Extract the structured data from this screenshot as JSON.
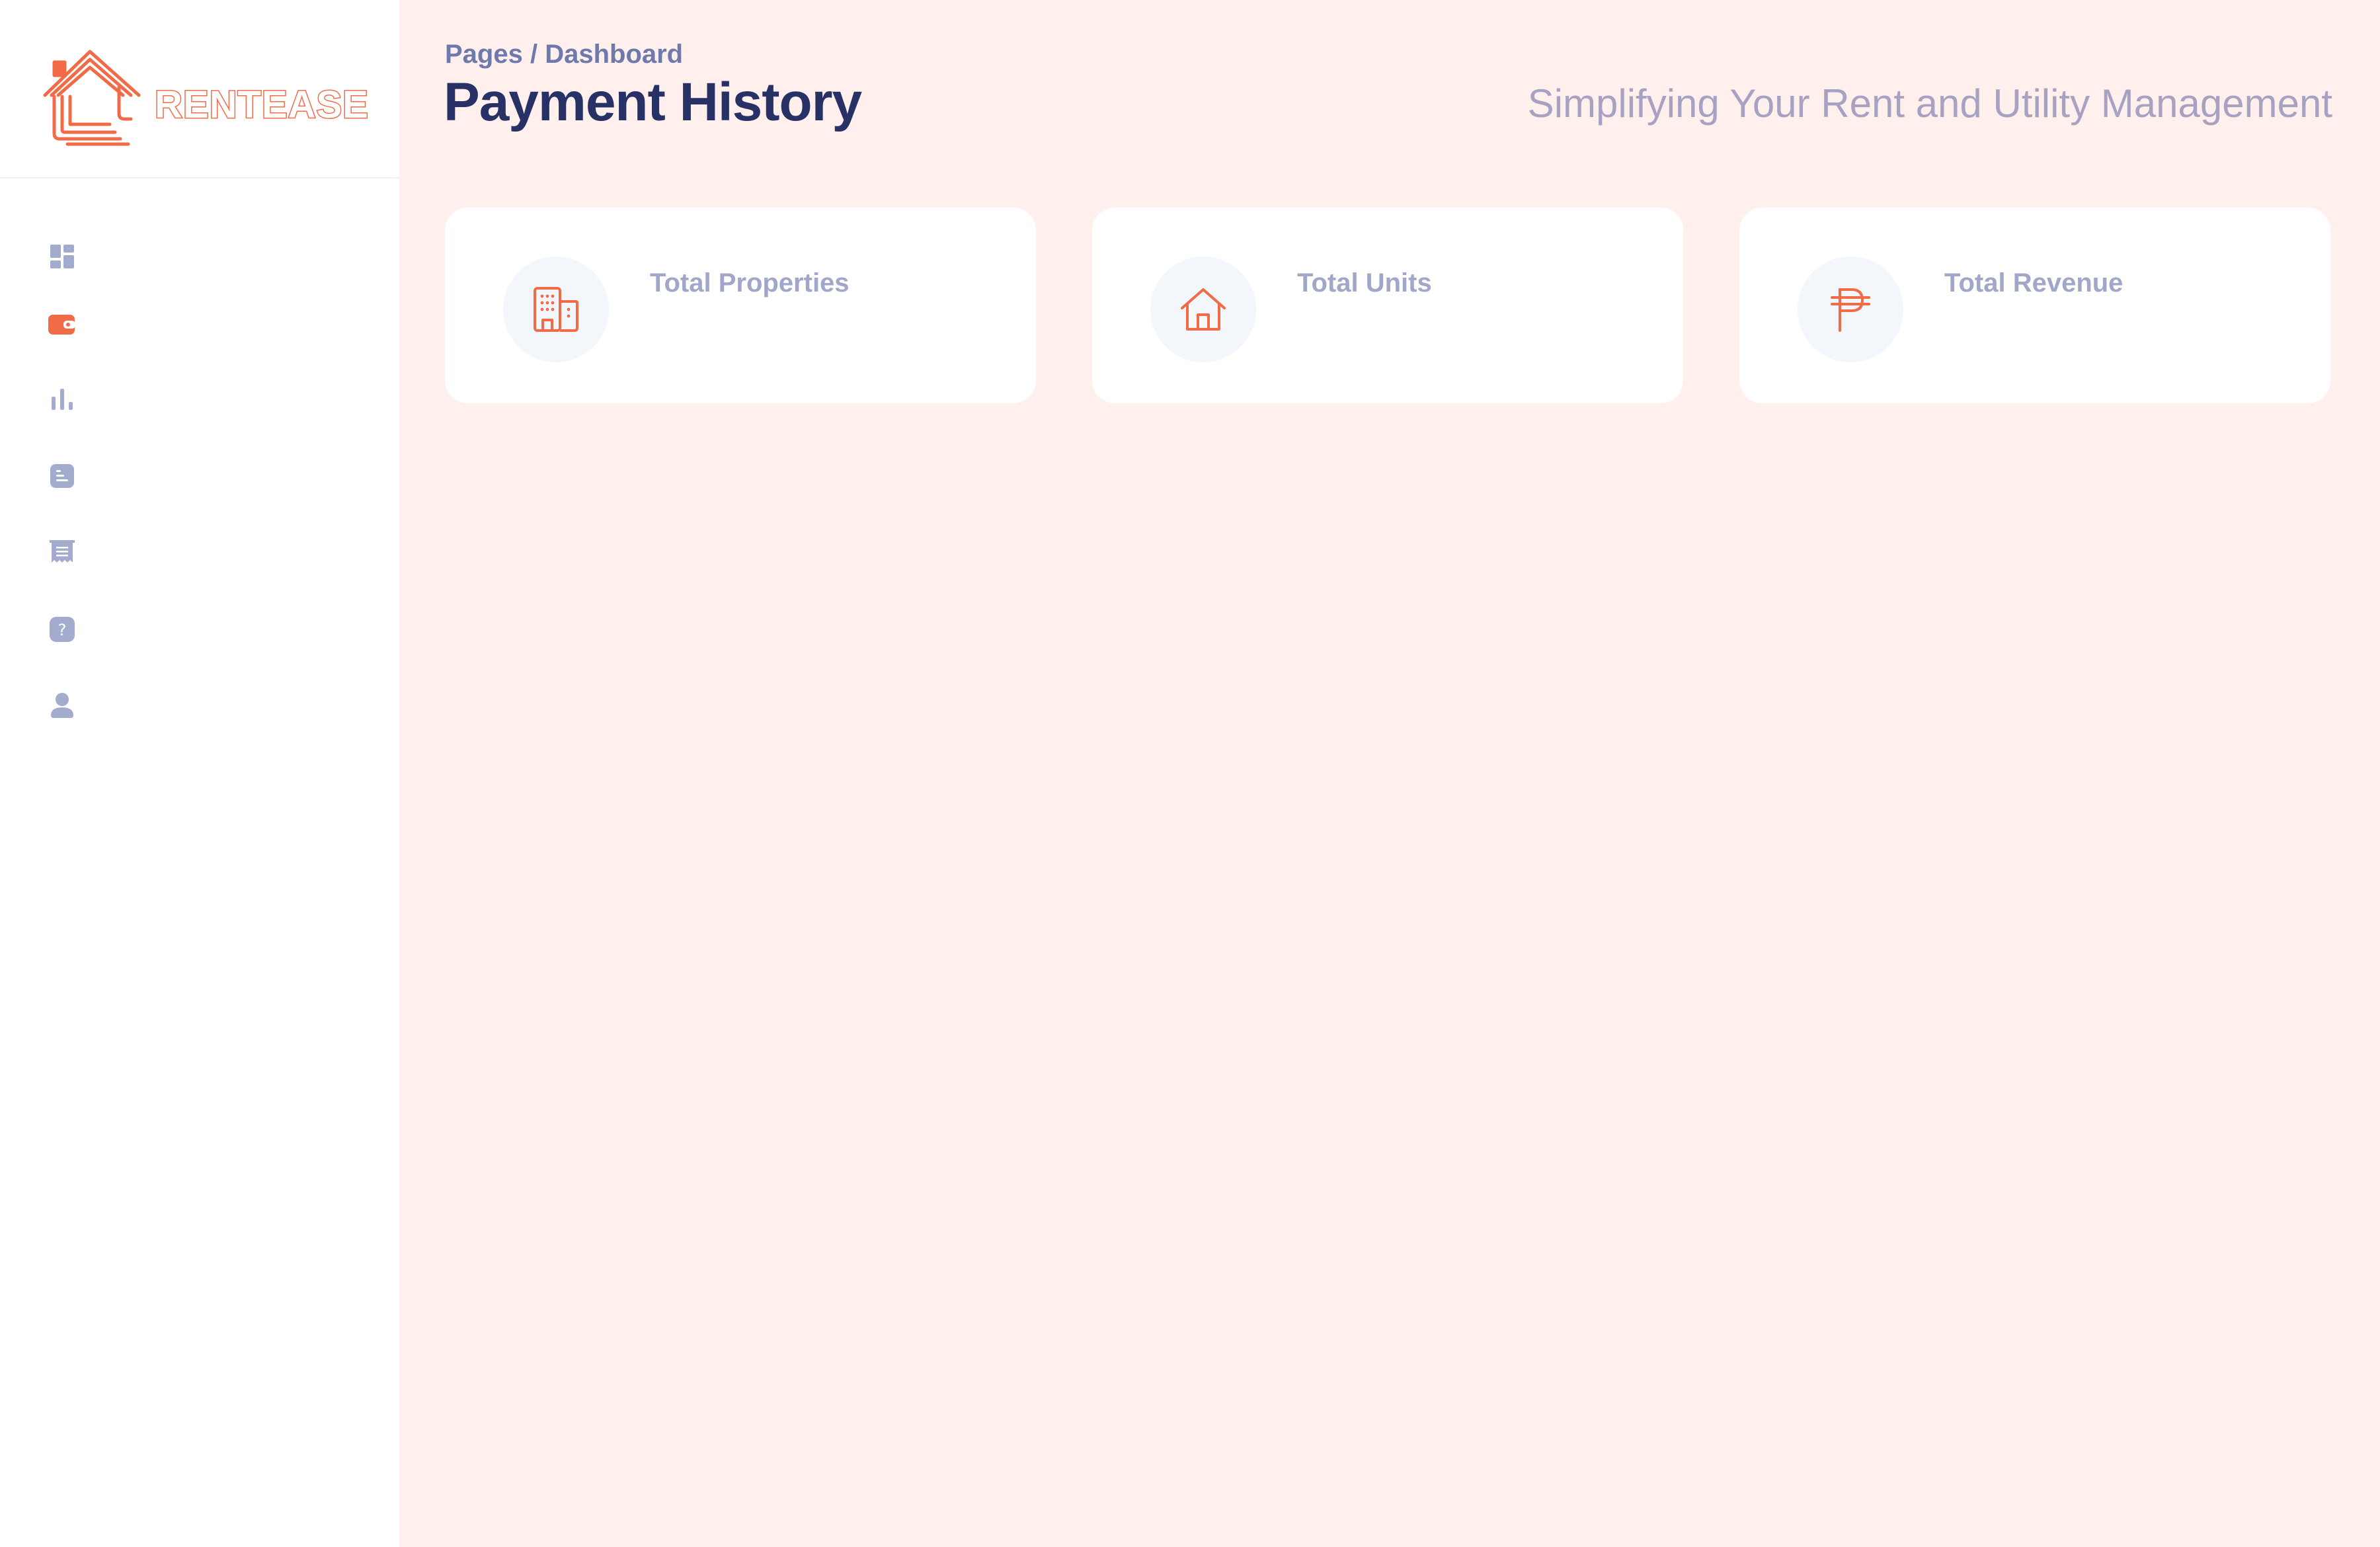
{
  "app": {
    "logo_text": "RENTEASE"
  },
  "colors": {
    "accent": "#f26b47",
    "nav_inactive": "#a3abcf",
    "page_bg": "#fff0ed",
    "title": "#273166"
  },
  "sidebar": {
    "items": [
      {
        "icon": "dashboard-icon",
        "active": false
      },
      {
        "icon": "wallet-icon",
        "active": true
      },
      {
        "icon": "bar-chart-icon",
        "active": false
      },
      {
        "icon": "document-icon",
        "active": false
      },
      {
        "icon": "receipt-icon",
        "active": false
      },
      {
        "icon": "help-icon",
        "active": false
      },
      {
        "icon": "user-icon",
        "active": false
      }
    ]
  },
  "header": {
    "breadcrumb": "Pages / Dashboard",
    "title": "Payment History",
    "tagline": "Simplifying Your Rent and Utility Management"
  },
  "stats": [
    {
      "label": "Total Properties",
      "icon": "building-icon"
    },
    {
      "label": "Total Units",
      "icon": "house-icon"
    },
    {
      "label": "Total Revenue",
      "icon": "peso-icon"
    }
  ]
}
